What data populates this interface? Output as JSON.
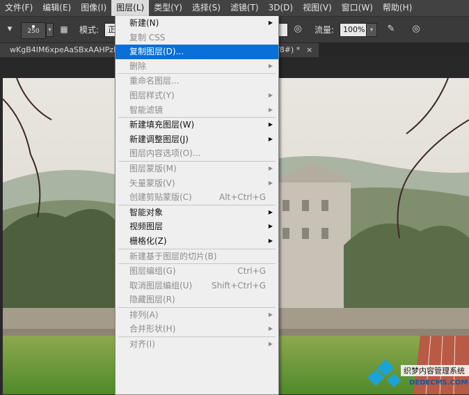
{
  "menubar": {
    "items": [
      {
        "label": "文件(F)"
      },
      {
        "label": "编辑(E)"
      },
      {
        "label": "图像(I)"
      },
      {
        "label": "图层(L)",
        "active": true
      },
      {
        "label": "类型(Y)"
      },
      {
        "label": "选择(S)"
      },
      {
        "label": "滤镜(T)"
      },
      {
        "label": "3D(D)"
      },
      {
        "label": "视图(V)"
      },
      {
        "label": "窗口(W)"
      },
      {
        "label": "帮助(H)"
      }
    ]
  },
  "options_bar": {
    "brush_size": "250",
    "mode_label": "模式:",
    "mode_value": "正",
    "flow_label": "流量:",
    "flow_value": "100%"
  },
  "document_tab": {
    "title": "wKgB4IM6xpeAaSBxAAHPzK",
    "title_tail": "/8#) *",
    "close": "×"
  },
  "layer_menu": {
    "items": [
      {
        "label": "新建(N)",
        "submenu": true,
        "disabled": false
      },
      {
        "label": "复制 CSS",
        "disabled": true
      },
      {
        "label": "复制图层(D)...",
        "highlighted": true,
        "disabled": false
      },
      {
        "label": "删除",
        "submenu": true,
        "disabled": true
      },
      {
        "separator": true
      },
      {
        "label": "重命名图层...",
        "disabled": true
      },
      {
        "label": "图层样式(Y)",
        "submenu": true,
        "disabled": true
      },
      {
        "label": "智能滤镜",
        "submenu": true,
        "disabled": true
      },
      {
        "separator": true
      },
      {
        "label": "新建填充图层(W)",
        "submenu": true,
        "disabled": false
      },
      {
        "label": "新建调整图层(J)",
        "submenu": true,
        "disabled": false
      },
      {
        "label": "图层内容选项(O)...",
        "disabled": true
      },
      {
        "separator": true
      },
      {
        "label": "图层蒙版(M)",
        "submenu": true,
        "disabled": true
      },
      {
        "label": "矢量蒙版(V)",
        "submenu": true,
        "disabled": true
      },
      {
        "label": "创建剪贴蒙版(C)",
        "shortcut": "Alt+Ctrl+G",
        "disabled": true
      },
      {
        "separator": true
      },
      {
        "label": "智能对象",
        "submenu": true,
        "disabled": false
      },
      {
        "label": "视频图层",
        "submenu": true,
        "disabled": false
      },
      {
        "label": "栅格化(Z)",
        "submenu": true,
        "disabled": false
      },
      {
        "separator": true
      },
      {
        "label": "新建基于图层的切片(B)",
        "disabled": true
      },
      {
        "separator": true
      },
      {
        "label": "图层编组(G)",
        "shortcut": "Ctrl+G",
        "disabled": true
      },
      {
        "label": "取消图层编组(U)",
        "shortcut": "Shift+Ctrl+G",
        "disabled": true
      },
      {
        "label": "隐藏图层(R)",
        "disabled": true
      },
      {
        "separator": true
      },
      {
        "label": "排列(A)",
        "submenu": true,
        "disabled": true
      },
      {
        "label": "合并形状(H)",
        "submenu": true,
        "disabled": true
      },
      {
        "separator": true
      },
      {
        "label": "对齐(I)",
        "submenu": true,
        "disabled": true
      }
    ]
  },
  "watermark": {
    "line1": "织梦内容管理系统",
    "line2": "DEDECMS.COM"
  },
  "icons": {
    "submenu_arrow": "triangle-right-icon",
    "dropdown": "chevron-down-icon"
  }
}
